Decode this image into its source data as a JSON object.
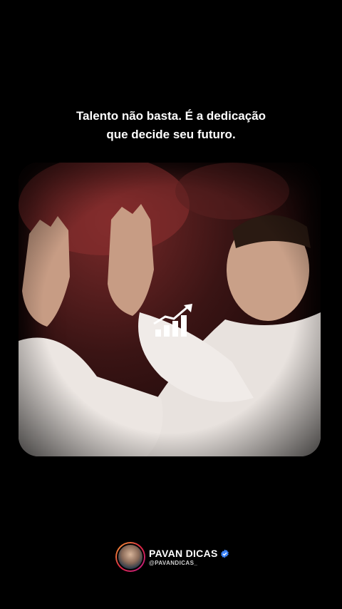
{
  "caption": {
    "line1": "Talento não basta. É a dedicação",
    "line2": "que decide seu futuro."
  },
  "video": {
    "icon": "growth-chart-icon"
  },
  "profile": {
    "name": "PAVAN DICAS",
    "handle": "@PAVANDICAS_",
    "verified_icon": "verified-badge-icon",
    "verified_color": "#3b82f6"
  }
}
